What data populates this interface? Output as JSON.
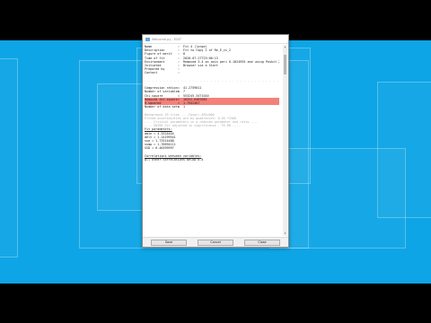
{
  "window": {
    "title": "Welcome.py - EDIT",
    "info": [
      {
        "key": "Name",
        "value": "Fit 4 (large)"
      },
      {
        "key": "Description",
        "value": "Fit to Copy 2 of Re_E_cc_2"
      },
      {
        "key": "Figure of merit",
        "value": "8"
      },
      {
        "key": "Time of fit",
        "value": "2020-07-27T23:06:13"
      },
      {
        "key": "Environment",
        "value": "Removed 3.4 on axis peri 0.1024955 and using Poskit 2"
      },
      {
        "key": "Initiated",
        "value": "Browser via a Start"
      },
      {
        "key": "Prepared by",
        "value": ""
      },
      {
        "key": "Contact",
        "value": ""
      }
    ],
    "rule_text": "- - - - - - - - - - - - - - - - - - - - - - - - - - - - - - - - - - - - - - - - - - - - - - - - - - - - - - - - - - - - - - - - - - - - -",
    "stats": [
      {
        "key": "Compression ration",
        "value": "41.2759011",
        "highlight": false
      },
      {
        "key": "Number of variables",
        "value": "7",
        "highlight": false
      },
      {
        "key": "Chi-square",
        "value": "553245.3471010",
        "highlight": false
      },
      {
        "key": "Reduced chi-square",
        "value": "10331.6487082",
        "highlight": true
      },
      {
        "key": "R-squared",
        "value": "1.7942467",
        "highlight": true
      },
      {
        "key": "Number of data sets",
        "value": "1",
        "highlight": false
      }
    ],
    "notes": [
      "Background 19 tries       ....Covar=-4E0+000",
      "  Fitted uncertainties are by quadrature: 0.05 *2560",
      "  .... Critical parameters in a reduced parameter and ratio ....",
      "  .... ENTER Fit adjusted in significance - FE-RH ....",
      "Fit parameters:",
      "  amin         =  4.3324444",
      "  delt         =  1.14199541",
      "  sse          =  1.73314488",
      "  ssmp         =  1.76694111",
      "  SSD          =  6.46399997"
    ],
    "correlation_title": "Correlations between variables:",
    "correlation_note": "All other correlations below 0.4",
    "buttons": {
      "save": "Save",
      "cancel": "Cancel",
      "close": "Close"
    }
  }
}
